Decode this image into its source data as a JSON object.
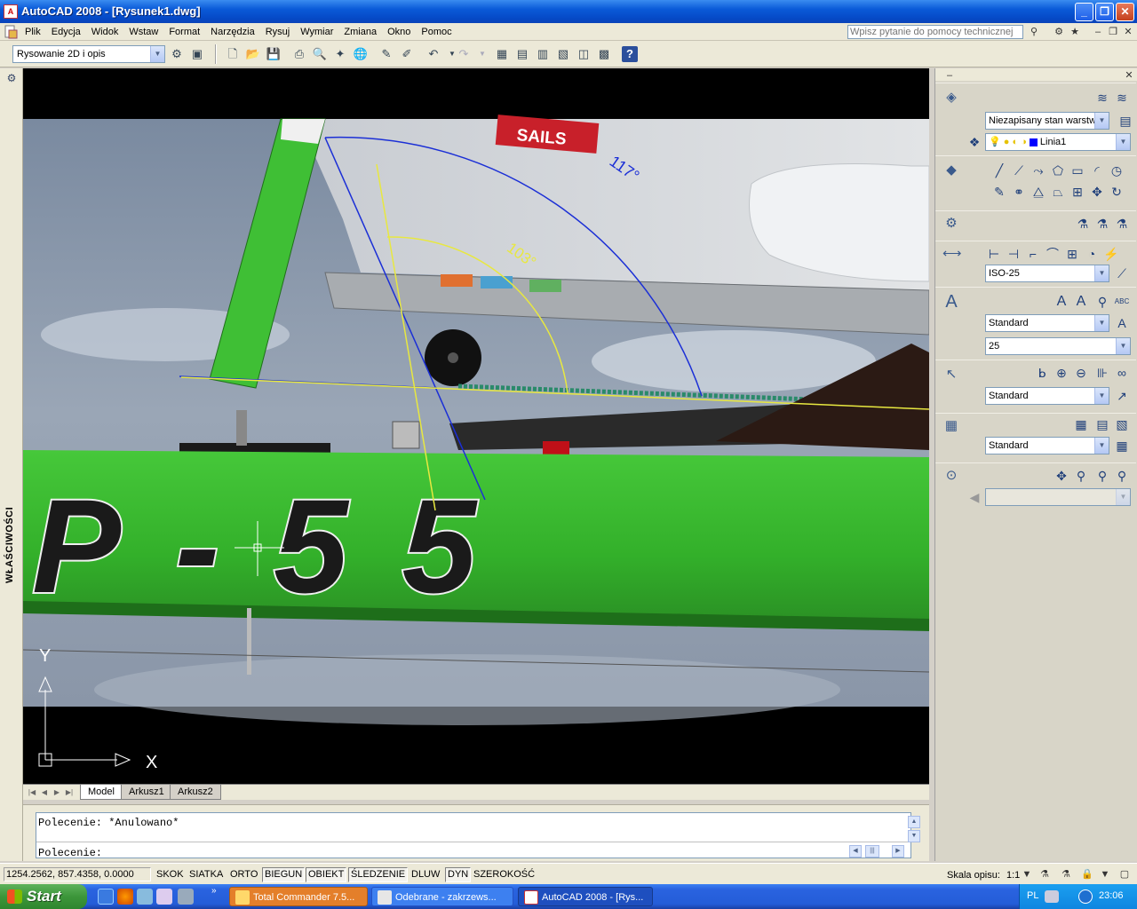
{
  "window": {
    "title": "AutoCAD 2008 - [Rysunek1.dwg]"
  },
  "menu": {
    "items": [
      "Plik",
      "Edycja",
      "Widok",
      "Wstaw",
      "Format",
      "Narzędzia",
      "Rysuj",
      "Wymiar",
      "Zmiana",
      "Okno",
      "Pomoc"
    ],
    "help_placeholder": "Wpisz pytanie do pomocy technicznej"
  },
  "toolbar": {
    "workspace": "Rysowanie 2D i opis"
  },
  "left_panel": {
    "properties_label": "WŁAŚCIWOŚCI"
  },
  "drawing": {
    "dimension_outer": "117°",
    "dimension_inner": "103°",
    "photo_text_sail": "SAILS",
    "photo_text_hull": "P-55",
    "ucs_x": "X",
    "ucs_y": "Y"
  },
  "layout_tabs": [
    "Model",
    "Arkusz1",
    "Arkusz2"
  ],
  "command_line": {
    "line1": "Polecenie: *Anulowano*",
    "line2": "Polecenie:"
  },
  "status": {
    "coords": "1254.2562, 857.4358, 0.0000",
    "buttons": [
      "SKOK",
      "SIATKA",
      "ORTO",
      "BIEGUN",
      "OBIEKT",
      "ŚLEDZENIE",
      "DLUW",
      "DYN",
      "SZEROKOŚĆ"
    ],
    "active": [
      false,
      false,
      false,
      true,
      true,
      true,
      false,
      true,
      false
    ],
    "scale_label": "Skala opisu:",
    "scale_value": "1:1"
  },
  "palette": {
    "layer_state": "Niezapisany stan warstw",
    "layer_name": "Linia1",
    "dim_style": "ISO-25",
    "text_style": "Standard",
    "text_height": "25",
    "multileader_style": "Standard",
    "table_style": "Standard"
  },
  "taskbar": {
    "start": "Start",
    "tasks": [
      "Total Commander 7.5...",
      "Odebrane - zakrzews...",
      "AutoCAD 2008 - [Rys..."
    ],
    "lang": "PL",
    "clock": "23:06"
  },
  "colors": {
    "dimension_blue": "#1b2fd6",
    "dimension_yellow": "#e8e840",
    "hull_green": "#3dbd2e",
    "titlebar": "#0a5ad8"
  }
}
